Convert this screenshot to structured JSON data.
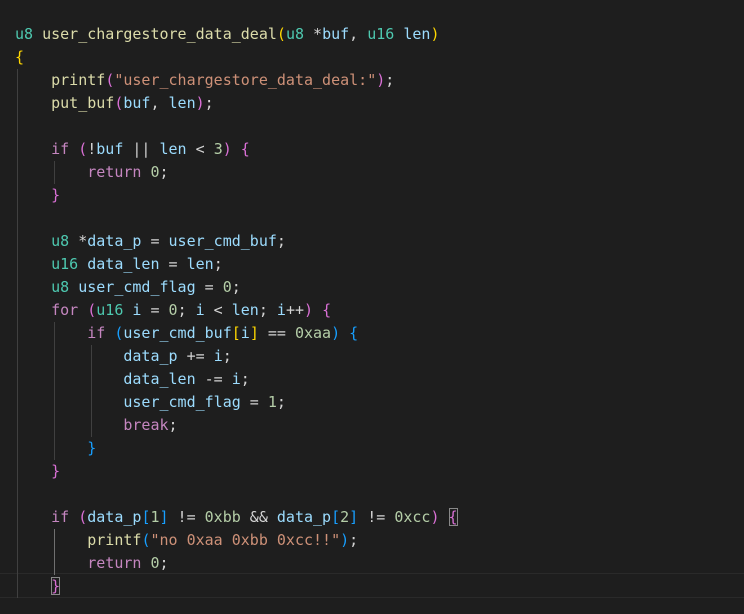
{
  "editor": {
    "lines": [
      [
        {
          "t": "u8",
          "c": "ty"
        },
        {
          "t": " "
        },
        {
          "t": "user_chargestore_data_deal",
          "c": "fn"
        },
        {
          "t": "(",
          "c": "b1"
        },
        {
          "t": "u8",
          "c": "ty"
        },
        {
          "t": " *"
        },
        {
          "t": "buf",
          "c": "var"
        },
        {
          "t": ", "
        },
        {
          "t": "u16",
          "c": "ty"
        },
        {
          "t": " "
        },
        {
          "t": "len",
          "c": "var"
        },
        {
          "t": ")",
          "c": "b1"
        }
      ],
      [
        {
          "t": "{",
          "c": "b1"
        }
      ],
      [
        {
          "t": "    "
        },
        {
          "t": "printf",
          "c": "fn"
        },
        {
          "t": "(",
          "c": "b2"
        },
        {
          "t": "\"user_chargestore_data_deal:\"",
          "c": "str"
        },
        {
          "t": ")",
          "c": "b2"
        },
        {
          "t": ";"
        }
      ],
      [
        {
          "t": "    "
        },
        {
          "t": "put_buf",
          "c": "fn"
        },
        {
          "t": "(",
          "c": "b2"
        },
        {
          "t": "buf",
          "c": "var"
        },
        {
          "t": ", "
        },
        {
          "t": "len",
          "c": "var"
        },
        {
          "t": ")",
          "c": "b2"
        },
        {
          "t": ";"
        }
      ],
      [],
      [
        {
          "t": "    "
        },
        {
          "t": "if",
          "c": "kw"
        },
        {
          "t": " "
        },
        {
          "t": "(",
          "c": "b2"
        },
        {
          "t": "!"
        },
        {
          "t": "buf",
          "c": "var"
        },
        {
          "t": " || "
        },
        {
          "t": "len",
          "c": "var"
        },
        {
          "t": " < "
        },
        {
          "t": "3",
          "c": "num"
        },
        {
          "t": ")",
          "c": "b2"
        },
        {
          "t": " "
        },
        {
          "t": "{",
          "c": "b2"
        }
      ],
      [
        {
          "t": "        "
        },
        {
          "t": "return",
          "c": "kw"
        },
        {
          "t": " "
        },
        {
          "t": "0",
          "c": "num"
        },
        {
          "t": ";"
        }
      ],
      [
        {
          "t": "    "
        },
        {
          "t": "}",
          "c": "b2"
        }
      ],
      [],
      [
        {
          "t": "    "
        },
        {
          "t": "u8",
          "c": "ty"
        },
        {
          "t": " *"
        },
        {
          "t": "data_p",
          "c": "var"
        },
        {
          "t": " = "
        },
        {
          "t": "user_cmd_buf",
          "c": "var"
        },
        {
          "t": ";"
        }
      ],
      [
        {
          "t": "    "
        },
        {
          "t": "u16",
          "c": "ty"
        },
        {
          "t": " "
        },
        {
          "t": "data_len",
          "c": "var"
        },
        {
          "t": " = "
        },
        {
          "t": "len",
          "c": "var"
        },
        {
          "t": ";"
        }
      ],
      [
        {
          "t": "    "
        },
        {
          "t": "u8",
          "c": "ty"
        },
        {
          "t": " "
        },
        {
          "t": "user_cmd_flag",
          "c": "var"
        },
        {
          "t": " = "
        },
        {
          "t": "0",
          "c": "num"
        },
        {
          "t": ";"
        }
      ],
      [
        {
          "t": "    "
        },
        {
          "t": "for",
          "c": "kw"
        },
        {
          "t": " "
        },
        {
          "t": "(",
          "c": "b2"
        },
        {
          "t": "u16",
          "c": "ty"
        },
        {
          "t": " "
        },
        {
          "t": "i",
          "c": "var"
        },
        {
          "t": " = "
        },
        {
          "t": "0",
          "c": "num"
        },
        {
          "t": "; "
        },
        {
          "t": "i",
          "c": "var"
        },
        {
          "t": " < "
        },
        {
          "t": "len",
          "c": "var"
        },
        {
          "t": "; "
        },
        {
          "t": "i",
          "c": "var"
        },
        {
          "t": "++"
        },
        {
          "t": ")",
          "c": "b2"
        },
        {
          "t": " "
        },
        {
          "t": "{",
          "c": "b2"
        }
      ],
      [
        {
          "t": "        "
        },
        {
          "t": "if",
          "c": "kw"
        },
        {
          "t": " "
        },
        {
          "t": "(",
          "c": "b3"
        },
        {
          "t": "user_cmd_buf",
          "c": "var"
        },
        {
          "t": "[",
          "c": "b1"
        },
        {
          "t": "i",
          "c": "var"
        },
        {
          "t": "]",
          "c": "b1"
        },
        {
          "t": " == "
        },
        {
          "t": "0xaa",
          "c": "num"
        },
        {
          "t": ")",
          "c": "b3"
        },
        {
          "t": " "
        },
        {
          "t": "{",
          "c": "b3"
        }
      ],
      [
        {
          "t": "            "
        },
        {
          "t": "data_p",
          "c": "var"
        },
        {
          "t": " += "
        },
        {
          "t": "i",
          "c": "var"
        },
        {
          "t": ";"
        }
      ],
      [
        {
          "t": "            "
        },
        {
          "t": "data_len",
          "c": "var"
        },
        {
          "t": " -= "
        },
        {
          "t": "i",
          "c": "var"
        },
        {
          "t": ";"
        }
      ],
      [
        {
          "t": "            "
        },
        {
          "t": "user_cmd_flag",
          "c": "var"
        },
        {
          "t": " = "
        },
        {
          "t": "1",
          "c": "num"
        },
        {
          "t": ";"
        }
      ],
      [
        {
          "t": "            "
        },
        {
          "t": "break",
          "c": "kw"
        },
        {
          "t": ";"
        }
      ],
      [
        {
          "t": "        "
        },
        {
          "t": "}",
          "c": "b3"
        }
      ],
      [
        {
          "t": "    "
        },
        {
          "t": "}",
          "c": "b2"
        }
      ],
      [],
      [
        {
          "t": "    "
        },
        {
          "t": "if",
          "c": "kw"
        },
        {
          "t": " "
        },
        {
          "t": "(",
          "c": "b2"
        },
        {
          "t": "data_p",
          "c": "var"
        },
        {
          "t": "[",
          "c": "b3"
        },
        {
          "t": "1",
          "c": "num"
        },
        {
          "t": "]",
          "c": "b3"
        },
        {
          "t": " != "
        },
        {
          "t": "0xbb",
          "c": "num"
        },
        {
          "t": " && "
        },
        {
          "t": "data_p",
          "c": "var"
        },
        {
          "t": "[",
          "c": "b3"
        },
        {
          "t": "2",
          "c": "num"
        },
        {
          "t": "]",
          "c": "b3"
        },
        {
          "t": " != "
        },
        {
          "t": "0xcc",
          "c": "num"
        },
        {
          "t": ")",
          "c": "b2"
        },
        {
          "t": " "
        },
        {
          "t": "{",
          "c": "b2 match"
        }
      ],
      [
        {
          "t": "        "
        },
        {
          "t": "printf",
          "c": "fn"
        },
        {
          "t": "(",
          "c": "b3"
        },
        {
          "t": "\"no 0xaa 0xbb 0xcc!!\"",
          "c": "str"
        },
        {
          "t": ")",
          "c": "b3"
        },
        {
          "t": ";"
        }
      ],
      [
        {
          "t": "        "
        },
        {
          "t": "return",
          "c": "kw"
        },
        {
          "t": " "
        },
        {
          "t": "0",
          "c": "num"
        },
        {
          "t": ";"
        }
      ],
      [
        {
          "t": "    "
        },
        {
          "t": "}",
          "c": "b2 match"
        }
      ]
    ]
  }
}
